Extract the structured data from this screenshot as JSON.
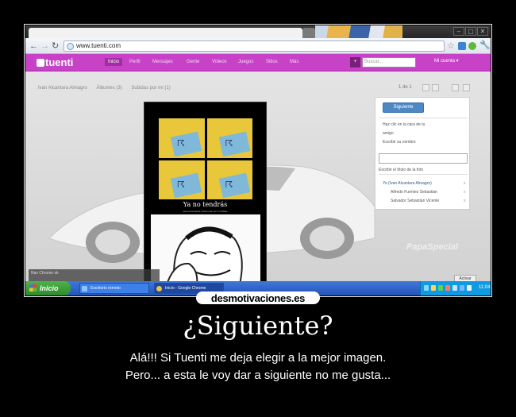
{
  "browser": {
    "url": "www.tuenti.com",
    "window_controls": [
      "–",
      "▢",
      "✕"
    ]
  },
  "tuenti": {
    "logo": "tuenti",
    "nav": [
      "Inicio",
      "Perfil",
      "Mensajes",
      "Gente",
      "Vídeos",
      "Juegos",
      "Sitios",
      "Más"
    ],
    "search_placeholder": "Buscar...",
    "account_label": "Mi cuenta ▾",
    "search_plus": "+"
  },
  "page": {
    "breadcrumbs": [
      "Ivan Alcantara Almagro",
      "Álbumes (3)",
      "Subidas por mí (1)"
    ],
    "pager": "1 de 1",
    "photo_caption": "Ya no tendrás",
    "photo_subcaption": "que preocuparte nunca mas por tu trabajo"
  },
  "sidebar": {
    "button": "Siguiente",
    "line1": "Haz clic en la cara de tu",
    "line2": "amigo",
    "line3": "Escribir su nombre",
    "hint": "Escribir el título de la foto",
    "people": [
      "Yo (Ivan Alcantara Almagro)",
      "Alfredo Fuentes Sebastian",
      "Salvador Sebastián Vicente"
    ],
    "remove": "x"
  },
  "activar": "Activar",
  "watermark": "PapaSpecial",
  "taskbar": {
    "start": "Inicio",
    "tasks": [
      "Escritorio remoto",
      "Inicio - Google Chrome"
    ],
    "clock": "11:04",
    "popup": "Nav Chrome ok"
  },
  "poster": {
    "site_logo": "desmotivaciones.es",
    "title": "¿Siguiente?",
    "lines": [
      "Alá!!! Si  Tuenti me deja elegir a la mejor imagen.",
      "Pero... a esta le voy dar a siguiente no me gusta..."
    ]
  },
  "colors": {
    "tuenti_magenta": "#c742c7",
    "taskbar_blue": "#2b5fc6",
    "start_green": "#3b9d38",
    "button_blue": "#4d88c4"
  }
}
